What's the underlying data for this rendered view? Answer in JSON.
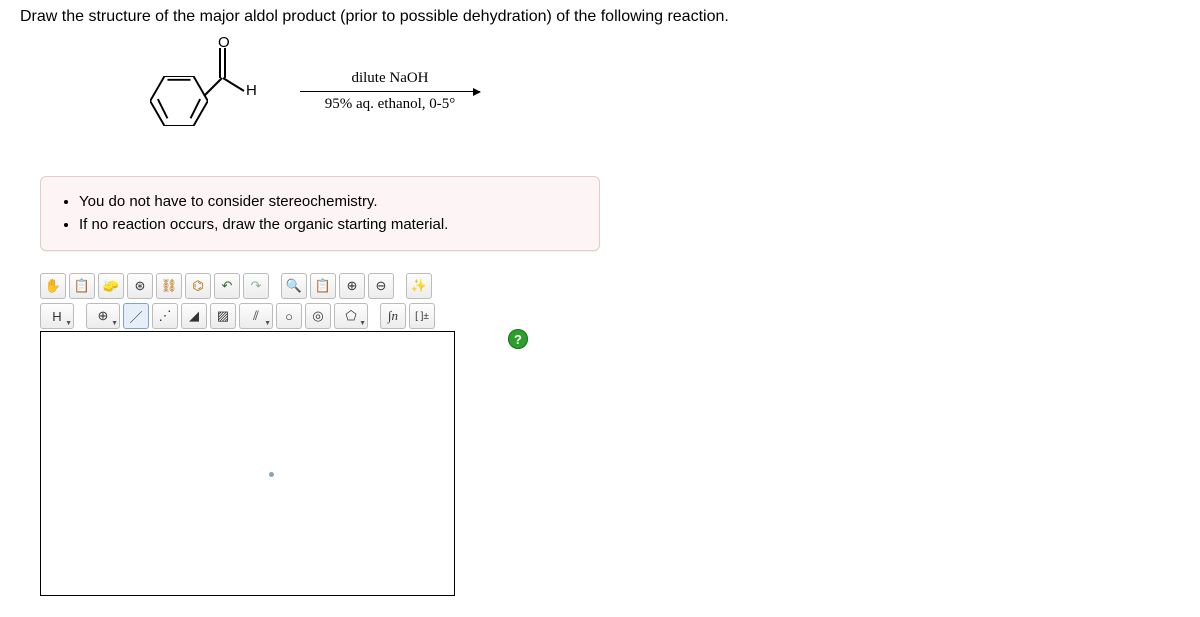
{
  "question": "Draw the structure of the major aldol product (prior to possible dehydration) of the following reaction.",
  "reaction": {
    "h_label": "H",
    "arrow_top": "dilute  NaOH",
    "arrow_bottom": "95% aq. ethanol, 0-5°"
  },
  "notes": [
    "You do not have to consider stereochemistry.",
    "If no reaction occurs, draw the organic starting material."
  ],
  "toolbar1": {
    "hand": "✋",
    "lasso": "📋",
    "erase": "🧽",
    "atom": "⊛",
    "chain": "⛓",
    "ring": "⌬",
    "undo": "↶",
    "redo": "↷",
    "view": "🔍",
    "paste": "📋",
    "zin": "⊕",
    "zout": "⊖",
    "clean": "✨"
  },
  "toolbar2": {
    "element": "H",
    "charge": "⊕",
    "bond1": "／",
    "bond_dots": "⋰",
    "wedge": "◢",
    "hash": "▨",
    "dbl": "⫽",
    "ring3": "○",
    "ring4": "◎",
    "ring5": "⬠",
    "sn": "∫n",
    "bracket": "[ ]±"
  },
  "help": "?"
}
